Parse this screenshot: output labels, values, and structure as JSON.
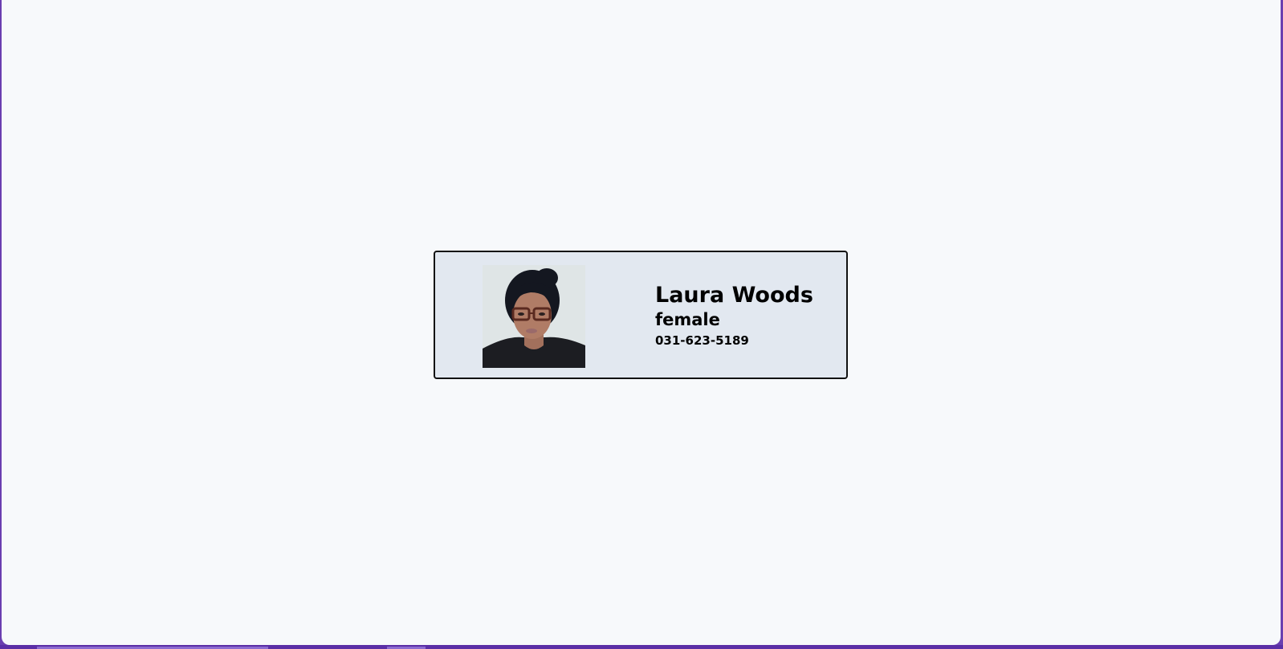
{
  "profile": {
    "name": "Laura Woods",
    "gender": "female",
    "phone": "031-623-5189",
    "photo_icon": "person-photo"
  },
  "colors": {
    "page_background": "#f7f9fb",
    "card_background": "#e2e8f0",
    "card_border": "#111111",
    "frame": "#6a3fb0"
  }
}
